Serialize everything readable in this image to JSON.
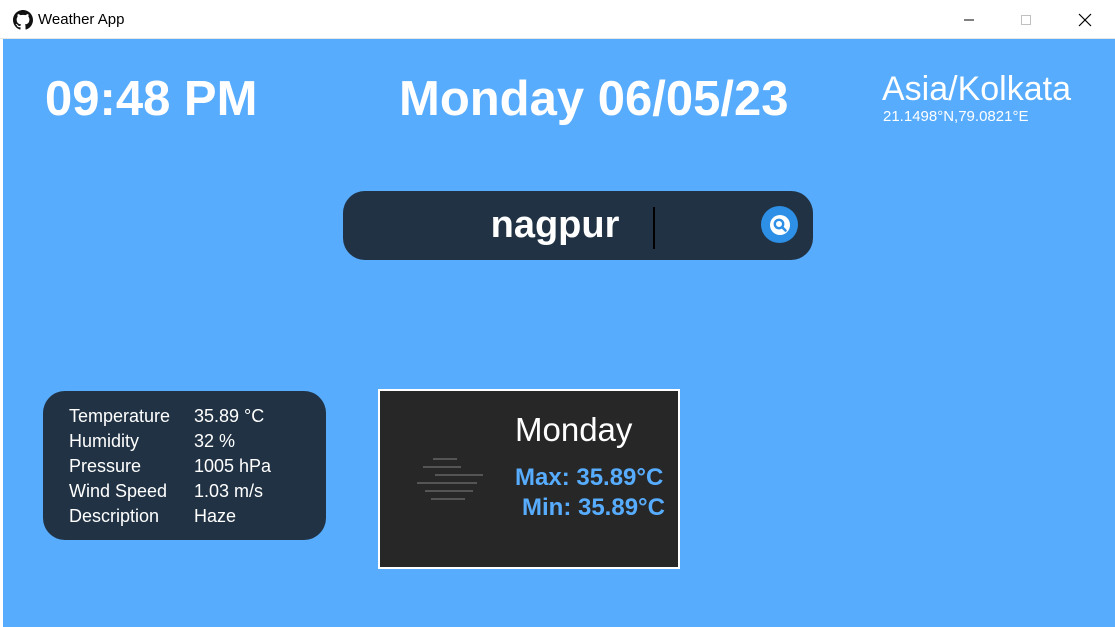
{
  "window": {
    "title": "Weather App",
    "icon": "github-icon"
  },
  "header": {
    "time": "09:48 PM",
    "date": "Monday 06/05/23",
    "timezone": "Asia/Kolkata",
    "coordinates": "21.1498°N,79.0821°E"
  },
  "search": {
    "value": "nagpur",
    "button_icon": "search-icon"
  },
  "current": {
    "rows": [
      {
        "label": "Temperature",
        "value": "35.89 °C"
      },
      {
        "label": "Humidity",
        "value": "32 %"
      },
      {
        "label": "Pressure",
        "value": "1005 hPa"
      },
      {
        "label": "Wind Speed",
        "value": "1.03 m/s"
      },
      {
        "label": "Description",
        "value": "Haze"
      }
    ]
  },
  "forecast": {
    "day": "Monday",
    "max": "Max: 35.89°C",
    "min": "Min: 35.89°C",
    "icon": "haze-icon"
  },
  "colors": {
    "background": "#57acfe",
    "card": "#203243",
    "forecast_card": "#272727",
    "accent": "#2d8fe6"
  }
}
